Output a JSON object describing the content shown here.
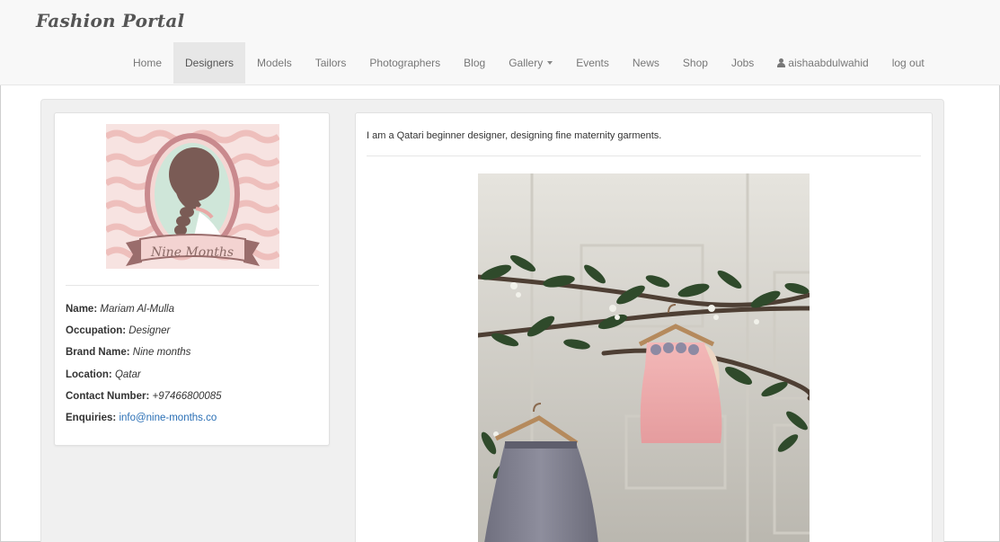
{
  "brand": "Fashion Portal",
  "nav": {
    "items": [
      {
        "label": "Home"
      },
      {
        "label": "Designers",
        "active": true
      },
      {
        "label": "Models"
      },
      {
        "label": "Tailors"
      },
      {
        "label": "Photographers"
      },
      {
        "label": "Blog"
      },
      {
        "label": "Gallery",
        "dropdown": true
      },
      {
        "label": "Events"
      },
      {
        "label": "News"
      },
      {
        "label": "Shop"
      },
      {
        "label": "Jobs"
      },
      {
        "label": "aishaabdulwahid",
        "icon": "user-icon"
      },
      {
        "label": "log out"
      }
    ]
  },
  "profile": {
    "logo_text": "Nine Months",
    "fields": [
      {
        "label": "Name:",
        "value": "Mariam Al-Mulla"
      },
      {
        "label": "Occupation:",
        "value": "Designer"
      },
      {
        "label": "Brand Name:",
        "value": "Nine months"
      },
      {
        "label": "Location:",
        "value": "Qatar"
      },
      {
        "label": "Contact Number:",
        "value": "+97466800085"
      },
      {
        "label": "Enquiries:",
        "value": "info@nine-months.co",
        "link": true
      }
    ]
  },
  "main": {
    "description": "I am a Qatari beginner designer, designing fine maternity garments."
  },
  "colors": {
    "navbar_bg": "#f8f8f8",
    "active_bg": "#e7e7e7",
    "link": "#2a6fb5",
    "well_bg": "#f0f0f0"
  }
}
